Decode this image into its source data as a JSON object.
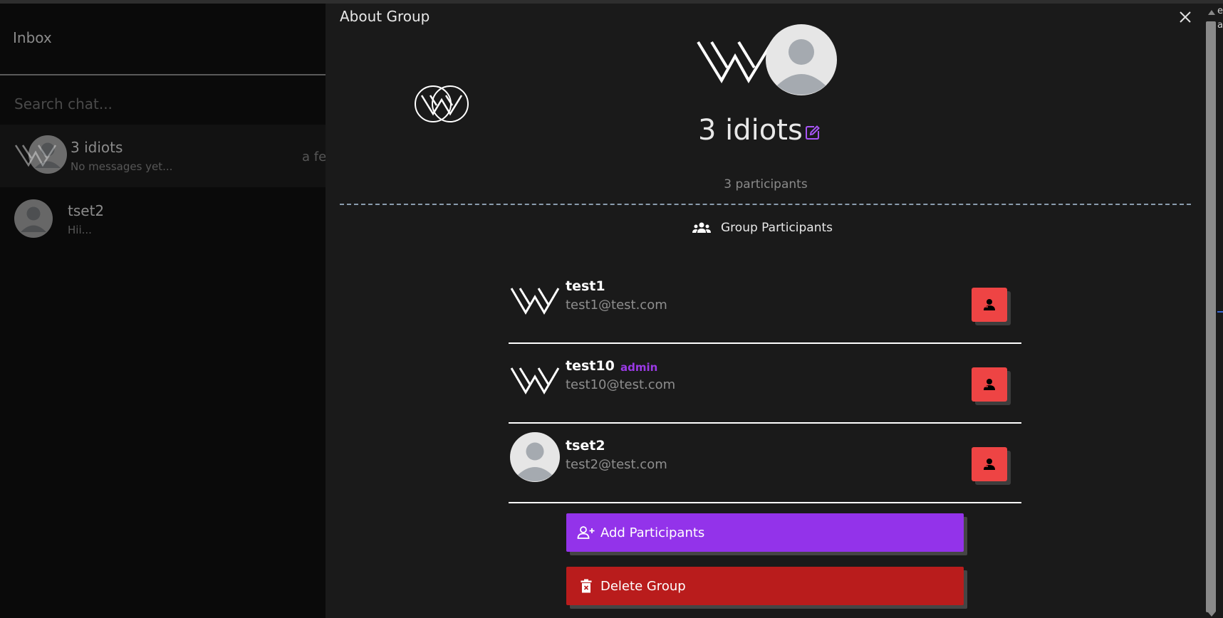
{
  "sidebar": {
    "title": "Inbox",
    "search_placeholder": "Search chat...",
    "chats": [
      {
        "name": "3 idiots",
        "preview": "No messages yet...",
        "time": "a fe"
      },
      {
        "name": "tset2",
        "preview": "Hii..."
      }
    ]
  },
  "modal": {
    "title": "About Group",
    "group_name": "3 idiots",
    "participant_count": "3 participants",
    "participants_heading": "Group Participants",
    "participants": [
      {
        "name": "test1",
        "email": "test1@test.com",
        "badge": "",
        "avatar": "logo-icon"
      },
      {
        "name": "test10",
        "email": "test10@test.com",
        "badge": "admin",
        "avatar": "logo-icon"
      },
      {
        "name": "tset2",
        "email": "test2@test.com",
        "badge": "",
        "avatar": "person-avatar"
      }
    ],
    "add_label": "Add Participants",
    "delete_label": "Delete Group"
  },
  "edge_text": [
    "e",
    "a"
  ],
  "colors": {
    "accent_purple": "#9333ea",
    "danger_red": "#ee4444",
    "delete_red": "#b91c1c",
    "modal_bg": "#1a1a1a",
    "sidebar_bg": "#0a0a0a"
  }
}
